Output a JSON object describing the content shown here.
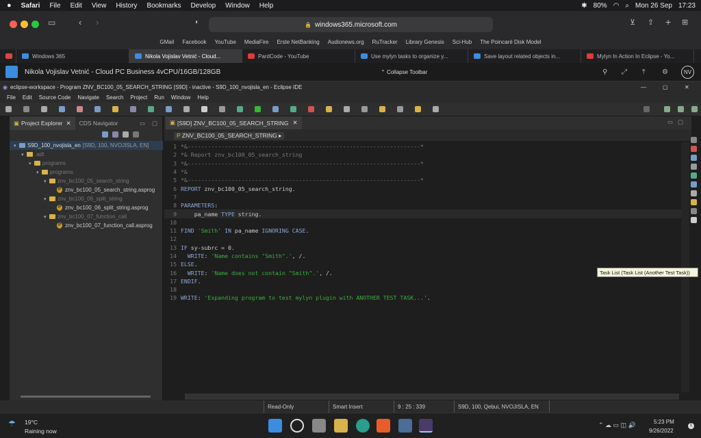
{
  "mac": {
    "app": "Safari",
    "menus": [
      "File",
      "Edit",
      "View",
      "History",
      "Bookmarks",
      "Develop",
      "Window",
      "Help"
    ],
    "battery": "80%",
    "date": "Mon 26 Sep",
    "time": "17:23"
  },
  "safari": {
    "url": "windows365.microsoft.com",
    "favorites": [
      "GMail",
      "Facebook",
      "YouTube",
      "MediaFire",
      "Erste NetBanking",
      "Audionews.org",
      "RuTracker",
      "Library Genesis",
      "Sci-Hub",
      "The Poincaré Disk Model"
    ],
    "tabs": [
      {
        "label": "Windows 365",
        "color": "#3a8de0"
      },
      {
        "label": "Nikola Vojislav Vetnić - Cloud...",
        "color": "#3a8de0"
      },
      {
        "label": "PardCode - YouTube",
        "color": "#e03a3a"
      },
      {
        "label": "Use mylyn tasks to organize y...",
        "color": "#3a8de0"
      },
      {
        "label": "Save layout related objects in...",
        "color": "#3a8de0"
      },
      {
        "label": "Mylyn In Action In Eclipse - Yo...",
        "color": "#e03a3a"
      }
    ]
  },
  "w365": {
    "title": "Nikola Vojislav Vetnić - Cloud PC Business 4vCPU/16GB/128GB",
    "collapse": "Collapse Toolbar",
    "avatar": "NV"
  },
  "eclipse": {
    "title": "eclipse-workspace - Program ZNV_BC100_05_SEARCH_STRING [S9D] - inactive - S9D_100_nvojisla_en - Eclipse IDE",
    "menus": [
      "File",
      "Edit",
      "Source Code",
      "Navigate",
      "Search",
      "Project",
      "Run",
      "Window",
      "Help"
    ],
    "left_tabs": [
      "Project Explorer",
      "CDS Navigator"
    ],
    "tree": [
      {
        "indent": 0,
        "arrow": "v",
        "type": "project",
        "label": "S9D_100_nvojisla_en",
        "suffix": "[S9D, 100, NVOJISLA, EN]"
      },
      {
        "indent": 1,
        "arrow": "v",
        "type": "folder",
        "label": ".adt",
        "suffix": ""
      },
      {
        "indent": 2,
        "arrow": "v",
        "type": "folder",
        "label": "programs",
        "suffix": ""
      },
      {
        "indent": 3,
        "arrow": "v",
        "type": "folder",
        "label": "programs",
        "suffix": ""
      },
      {
        "indent": 4,
        "arrow": "v",
        "type": "folder",
        "label": "znv_bc100_05_search_string",
        "suffix": ""
      },
      {
        "indent": 5,
        "arrow": "",
        "type": "file",
        "label": "znv_bc100_05_search_string.asprog",
        "suffix": ""
      },
      {
        "indent": 4,
        "arrow": "v",
        "type": "folder",
        "label": "znv_bc100_06_split_string",
        "suffix": ""
      },
      {
        "indent": 5,
        "arrow": "",
        "type": "file",
        "label": "znv_bc100_06_split_string.asprog",
        "suffix": ""
      },
      {
        "indent": 4,
        "arrow": "v",
        "type": "folder",
        "label": "znv_bc100_07_function_call",
        "suffix": ""
      },
      {
        "indent": 5,
        "arrow": "",
        "type": "file",
        "label": "znv_bc100_07_function_call.asprog",
        "suffix": ""
      }
    ],
    "editor_tab": "[S9D] ZNV_BC100_05_SEARCH_STRING",
    "breadcrumb": "ZNV_BC100_05_SEARCH_STRING",
    "code": [
      [
        [
          "cm",
          "*&---------------------------------------------------------------------*"
        ]
      ],
      [
        [
          "cm",
          "*& Report znv_bc100_05_search_string"
        ]
      ],
      [
        [
          "cm",
          "*&---------------------------------------------------------------------*"
        ]
      ],
      [
        [
          "cm",
          "*&"
        ]
      ],
      [
        [
          "cm",
          "*&---------------------------------------------------------------------*"
        ]
      ],
      [
        [
          "kw",
          "REPORT"
        ],
        [
          "tx",
          " znv_bc100_05_search_string."
        ]
      ],
      [],
      [
        [
          "kw",
          "PARAMETERS"
        ],
        [
          "tx",
          ":"
        ]
      ],
      [
        [
          "tx",
          "    pa_name "
        ],
        [
          "kw",
          "TYPE"
        ],
        [
          "tx",
          " string."
        ]
      ],
      [],
      [
        [
          "kw",
          "FIND"
        ],
        [
          "tx",
          " "
        ],
        [
          "str",
          "'Smith'"
        ],
        [
          "tx",
          " "
        ],
        [
          "kw",
          "IN"
        ],
        [
          "tx",
          " pa_name "
        ],
        [
          "kw",
          "IGNORING CASE"
        ],
        [
          "tx",
          "."
        ]
      ],
      [],
      [
        [
          "kw",
          "IF"
        ],
        [
          "tx",
          " sy-subrc = 0."
        ]
      ],
      [
        [
          "kw",
          "  WRITE"
        ],
        [
          "tx",
          ": "
        ],
        [
          "str",
          "'Name contains \"Smith\".'"
        ],
        [
          "tx",
          ", /."
        ]
      ],
      [
        [
          "kw",
          "ELSE"
        ],
        [
          "tx",
          "."
        ]
      ],
      [
        [
          "kw",
          "  WRITE"
        ],
        [
          "tx",
          ": "
        ],
        [
          "str",
          "'Name does not contain \"Smith\".'"
        ],
        [
          "tx",
          ", /."
        ]
      ],
      [
        [
          "kw",
          "ENDIF"
        ],
        [
          "tx",
          "."
        ]
      ],
      [],
      [
        [
          "kw",
          "WRITE"
        ],
        [
          "tx",
          ": "
        ],
        [
          "str",
          "'Expanding program to test mylyn plugin with ANOTHER TEST TASK...'"
        ],
        [
          "tx",
          "."
        ]
      ]
    ],
    "tooltip": "Task List (Task List (Another Test Task))",
    "status": {
      "mode": "Read-Only",
      "insert": "Smart Insert",
      "pos": "9 : 25 : 339",
      "system": "S9D, 100, Qebui, NVOJISLA, EN"
    }
  },
  "taskbar": {
    "weather_temp": "19°C",
    "weather_desc": "Raining now",
    "time": "5:23 PM",
    "date": "9/26/2022"
  }
}
